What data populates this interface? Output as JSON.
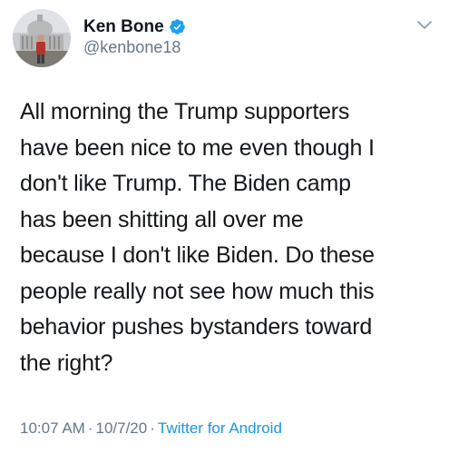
{
  "tweet": {
    "author": {
      "display_name": "Ken Bone",
      "handle": "@kenbone18",
      "verified": true
    },
    "text_lines": [
      "All morning the Trump supporters",
      "have been nice to me even though I",
      "don't like Trump. The Biden camp",
      "has been shitting all over me",
      "because I don't like Biden. Do these",
      "people really not see how much this",
      "behavior pushes bystanders toward",
      "the right?"
    ],
    "time": "10:07 AM",
    "date": "10/7/20",
    "separator": "·",
    "source": "Twitter for Android"
  },
  "icons": {
    "verified": "verified-badge-icon",
    "menu": "chevron-down-icon"
  },
  "colors": {
    "text": "#14171a",
    "secondary": "#657786",
    "link": "#1b95e0",
    "verified": "#1da1f2"
  }
}
